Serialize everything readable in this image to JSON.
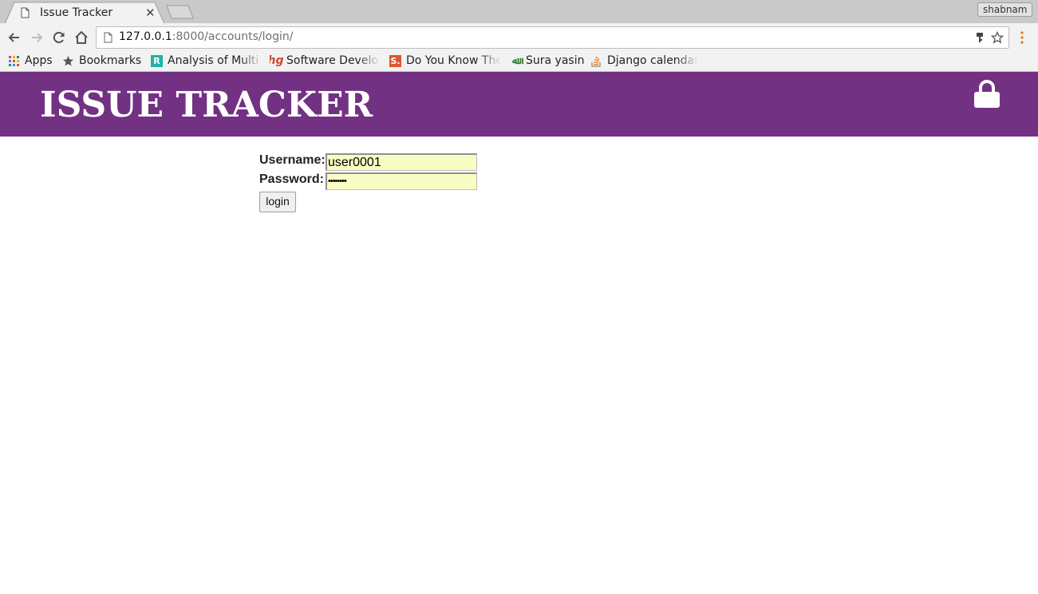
{
  "browser": {
    "tab": {
      "title": "Issue Tracker"
    },
    "profile_name": "shabnam",
    "url": {
      "host": "127.0.0.1",
      "path": ":8000/accounts/login/"
    },
    "bookmarks": [
      {
        "label": "Apps",
        "icon": "apps-grid-icon"
      },
      {
        "label": "Bookmarks",
        "icon": "star-icon"
      },
      {
        "label": "Analysis of Multi",
        "icon": "rstudio-icon"
      },
      {
        "label": "Software Develo",
        "icon": "hg-icon"
      },
      {
        "label": "Do You Know The",
        "icon": "s-icon"
      },
      {
        "label": "Sura yasin",
        "icon": "arabic-icon"
      },
      {
        "label": "Django calendar",
        "icon": "stackoverflow-icon"
      }
    ]
  },
  "page": {
    "site_title": "ISSUE TRACKER",
    "header_color": "#723182",
    "form": {
      "username_label": "Username:",
      "username_value": "user0001",
      "password_label": "Password:",
      "password_mask": "••••••••",
      "submit_label": "login"
    },
    "autofill_color": "#fafdc3"
  }
}
